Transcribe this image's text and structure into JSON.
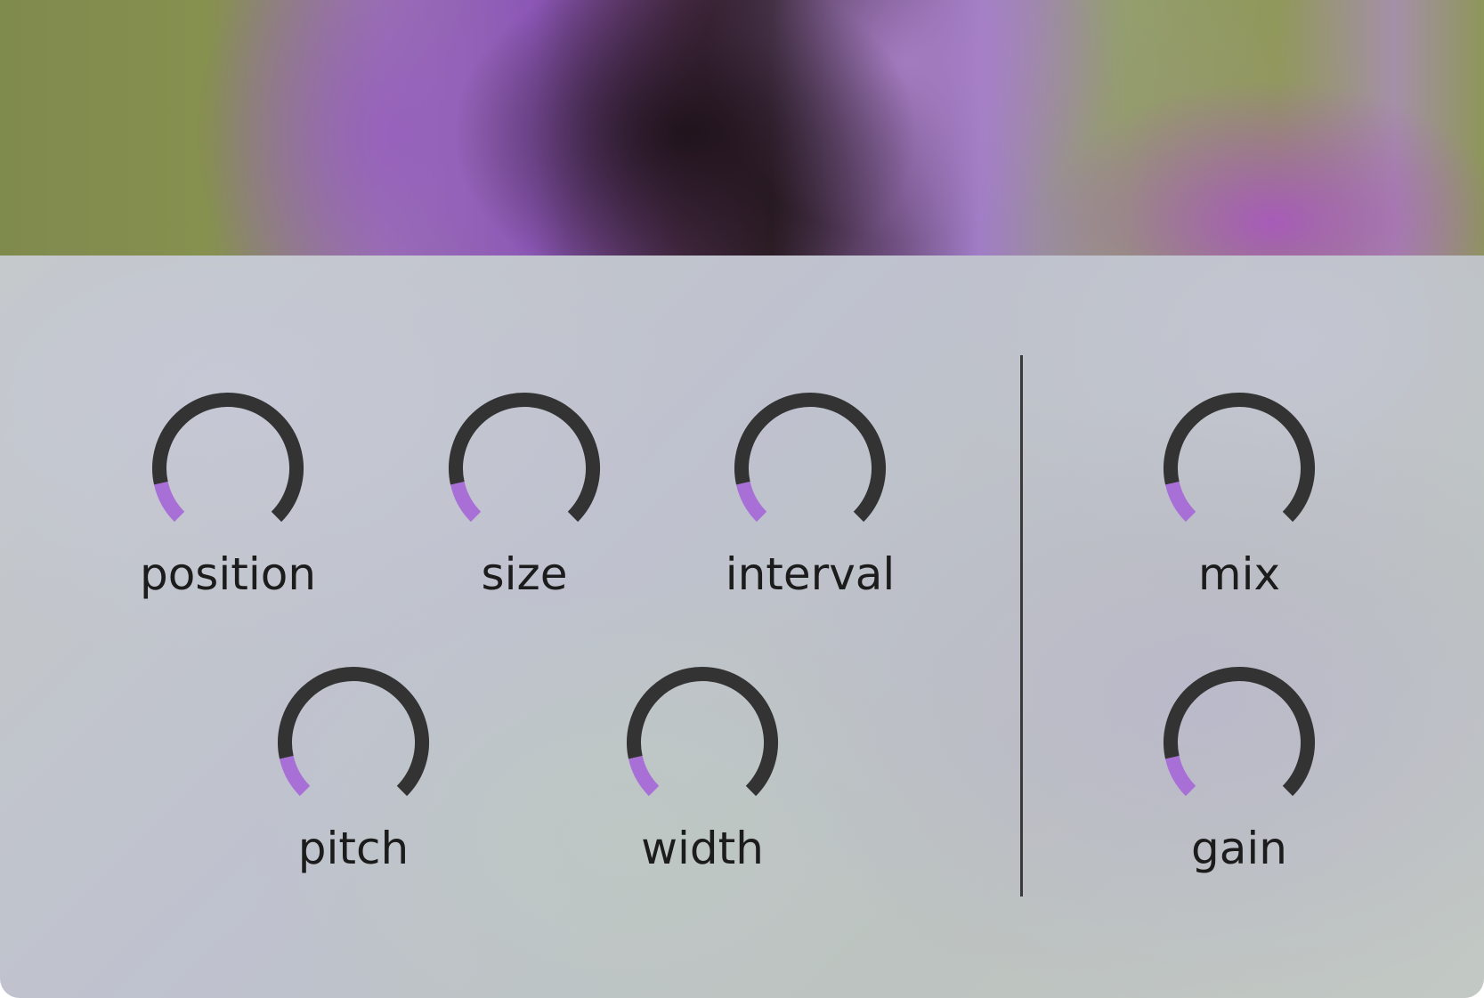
{
  "colors": {
    "track": "#333333",
    "value": "#a86fd6",
    "label": "#1c1c1c",
    "divider": "#3a3a3a"
  },
  "knobs": [
    {
      "id": "position",
      "label": "position",
      "value": 0.12
    },
    {
      "id": "size",
      "label": "size",
      "value": 0.12
    },
    {
      "id": "interval",
      "label": "interval",
      "value": 0.12
    },
    {
      "id": "pitch",
      "label": "pitch",
      "value": 0.12
    },
    {
      "id": "width",
      "label": "width",
      "value": 0.12
    },
    {
      "id": "mix",
      "label": "mix",
      "value": 0.12
    },
    {
      "id": "gain",
      "label": "gain",
      "value": 0.12
    }
  ]
}
